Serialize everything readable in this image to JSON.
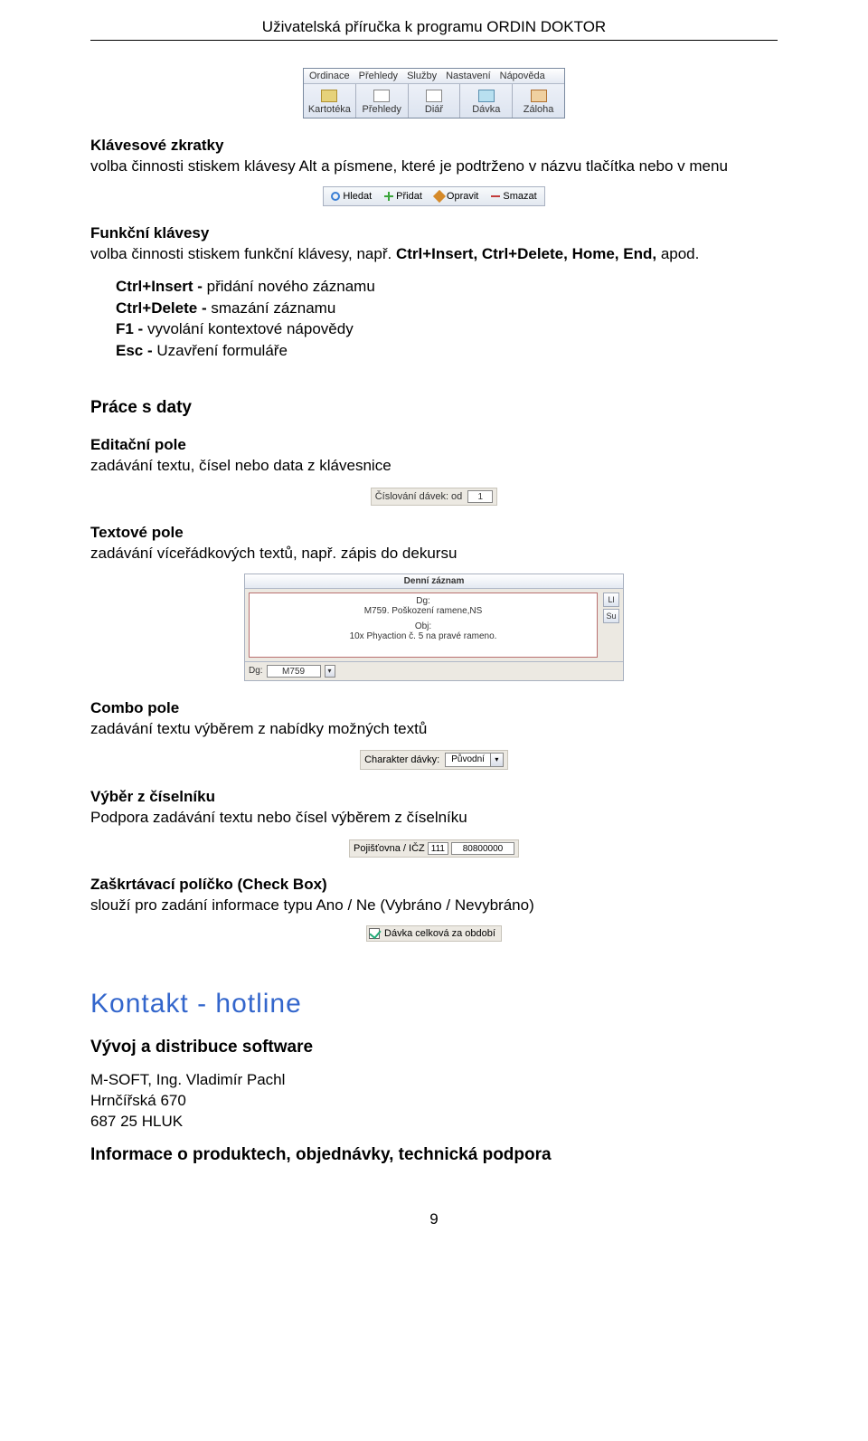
{
  "header": {
    "title": "Uživatelská příručka k programu ORDIN DOKTOR"
  },
  "toolbar": {
    "menu": [
      "Ordinace",
      "Přehledy",
      "Služby",
      "Nastavení",
      "Nápověda"
    ],
    "buttons": [
      "Kartotéka",
      "Přehledy",
      "Diář",
      "Dávka",
      "Záloha"
    ]
  },
  "s1": {
    "title": "Klávesové zkratky",
    "text": "volba činnosti stiskem klávesy Alt a písmene, které je podtrženo v názvu tlačítka nebo v menu"
  },
  "actionbar": {
    "items": [
      {
        "label": "Hledat",
        "color": "#3a7fd5"
      },
      {
        "label": "Přidat",
        "color": "#3aa53a"
      },
      {
        "label": "Opravit",
        "color": "#d58a2a"
      },
      {
        "label": "Smazat",
        "color": "#c23b3b"
      }
    ]
  },
  "s2": {
    "title": "Funkční klávesy",
    "text_pre": "volba činnosti stiskem funkční klávesy, např. ",
    "text_bold": "Ctrl+Insert, Ctrl+Delete, Home, End,",
    "text_post": " apod.",
    "bullets": [
      {
        "b": "Ctrl+Insert - ",
        "t": "přidání nového záznamu"
      },
      {
        "b": "Ctrl+Delete - ",
        "t": "smazání záznamu"
      },
      {
        "b": "F1 - ",
        "t": "vyvolání kontextové nápovědy"
      },
      {
        "b": "Esc - ",
        "t": "Uzavření formuláře"
      }
    ]
  },
  "s3": {
    "title": "Práce s daty"
  },
  "edit": {
    "title": "Editační pole",
    "text": "zadávání textu, čísel nebo data z klávesnice",
    "widget": {
      "label": "Číslování dávek: od",
      "value": "1"
    }
  },
  "textarea": {
    "title": "Textové pole",
    "text": "zadávání víceřádkových textů, např. zápis do dekursu",
    "widget": {
      "caption": "Denní záznam",
      "line1": "Dg:",
      "line2": "M759.   Poškození ramene,NS",
      "line3": "Obj:",
      "line4": "10x Phyaction č. 5 na pravé rameno.",
      "side": [
        "Ll",
        "Su"
      ],
      "foot_label": "Dg:",
      "foot_value": "M759"
    }
  },
  "combo": {
    "title": "Combo pole",
    "text": "zadávání textu výběrem z nabídky možných textů",
    "widget": {
      "label": "Charakter dávky:",
      "value": "Původní"
    }
  },
  "lookup": {
    "title": "Výběr z číselníku",
    "text": "Podpora zadávání textu nebo čísel výběrem z číselníku",
    "widget": {
      "label": "Pojišťovna / IČZ",
      "code": "111",
      "value": "80800000"
    }
  },
  "check": {
    "title": "Zaškrtávací políčko (Check Box)",
    "text": "slouží pro zadání informace typu Ano / Ne (Vybráno / Nevybráno)",
    "widget": {
      "label": "Dávka celková za období"
    }
  },
  "contact": {
    "title": "Kontakt - hotline",
    "sub": "Vývoj a distribuce software",
    "l1": "M-SOFT, Ing. Vladimír Pachl",
    "l2": "Hrnčířská 670",
    "l3": "687 25 HLUK",
    "info": "Informace o produktech, objednávky, technická podpora"
  },
  "pagenum": "9"
}
